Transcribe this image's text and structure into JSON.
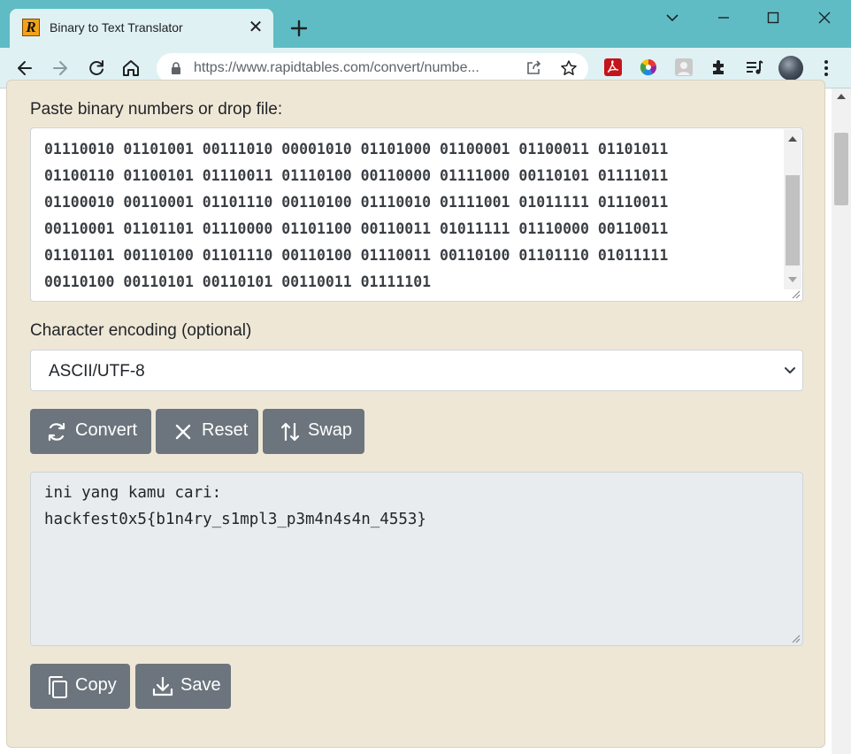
{
  "browser": {
    "tab_title": "Binary to Text Translator",
    "favicon_letter": "R",
    "url": "https://www.rapidtables.com/convert/numbe...",
    "tab_close": "✕"
  },
  "icons": {
    "favicon": "rapidtables-favicon-icon",
    "new_tab": "plus-icon",
    "window_controls": [
      "chevron-down-icon",
      "minimize-icon",
      "maximize-icon",
      "close-icon"
    ],
    "nav": [
      "back-arrow-icon",
      "forward-arrow-icon",
      "reload-icon",
      "home-icon"
    ],
    "omnibox": [
      "lock-icon",
      "share-icon",
      "star-icon"
    ],
    "extensions": [
      "pdf-icon",
      "color-wheel-icon",
      "profile-ext-icon",
      "puzzle-icon",
      "media-queue-icon"
    ],
    "menu": "kebab-menu-icon",
    "buttons": [
      "refresh-cycle-icon",
      "x-icon",
      "swap-arrows-icon",
      "copy-icon",
      "download-icon"
    ]
  },
  "form": {
    "binary_label": "Paste binary numbers or drop file:",
    "binary_value": "01110010 01101001 00111010 00001010 01101000 01100001 01100011 01101011\n01100110 01100101 01110011 01110100 00110000 01111000 00110101 01111011\n01100010 00110001 01101110 00110100 01110010 01111001 01011111 01110011\n00110001 01101101 01110000 01101100 00110011 01011111 01110000 00110011\n01101101 00110100 01101110 00110100 01110011 00110100 01101110 01011111\n00110100 00110101 00110101 00110011 01111101",
    "encoding_label": "Character encoding (optional)",
    "encoding_value": "ASCII/UTF-8",
    "output_value": "ini yang kamu cari:\nhackfest0x5{b1n4ry_s1mpl3_p3m4n4s4n_4553}"
  },
  "buttons": {
    "convert": "Convert",
    "reset": "Reset",
    "swap": "Swap",
    "copy": "Copy",
    "save": "Save"
  },
  "colors": {
    "titlebar": "#5fbcc5",
    "toolbar": "#dff1f3",
    "panel": "#efe7d6",
    "button": "#6c757d",
    "output_bg": "#e9ecef"
  }
}
